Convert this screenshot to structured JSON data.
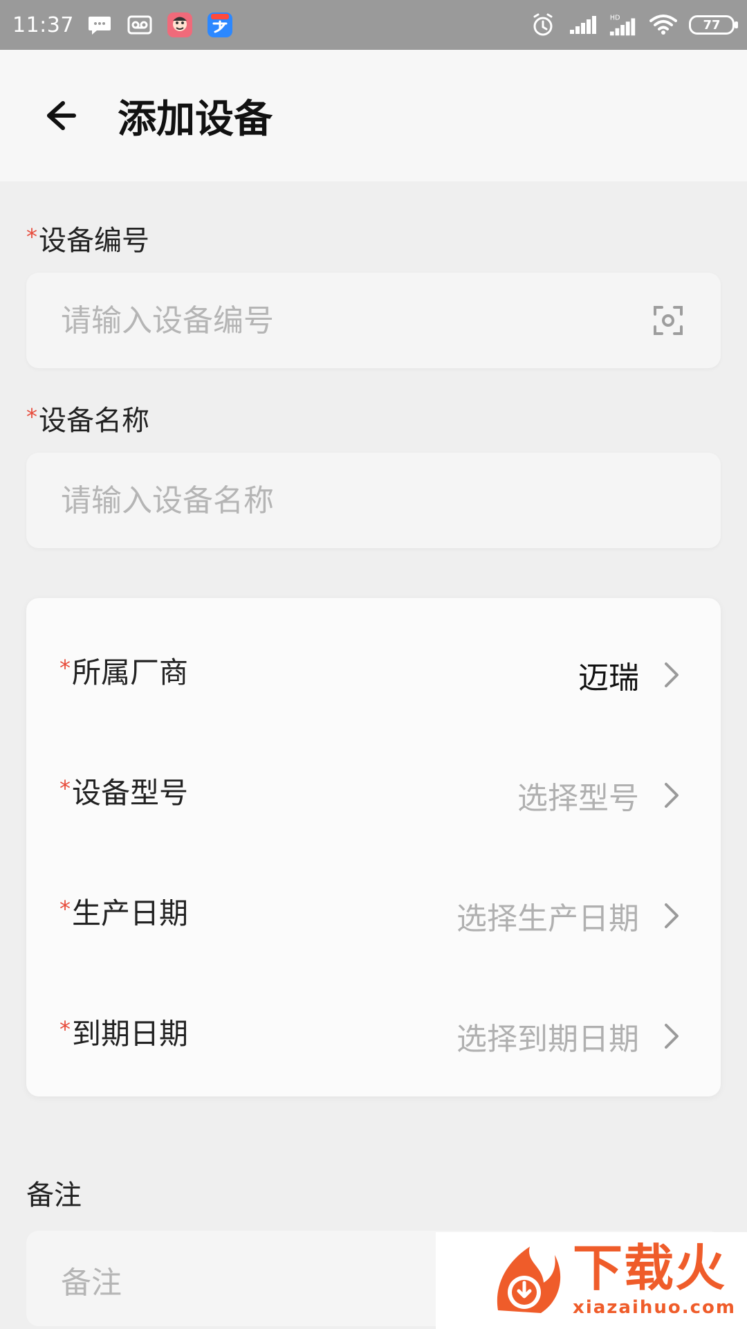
{
  "status_bar": {
    "time": "11:37",
    "battery": "77",
    "left_icons": [
      "message-icon",
      "voicemail-icon",
      "app-avatar-icon",
      "alipay-icon"
    ],
    "right_icons": [
      "alarm-icon",
      "signal-icon",
      "hd-signal-icon",
      "wifi-icon",
      "battery-icon"
    ]
  },
  "header": {
    "title": "添加设备",
    "back_icon": "back-arrow-icon"
  },
  "form": {
    "device_number": {
      "label": "设备编号",
      "placeholder": "请输入设备编号",
      "value": "",
      "required": "*"
    },
    "device_name": {
      "label": "设备名称",
      "placeholder": "请输入设备名称",
      "value": "",
      "required": "*"
    },
    "card_rows": [
      {
        "required": "*",
        "label": "所属厂商",
        "value": "迈瑞",
        "state": "selected"
      },
      {
        "required": "*",
        "label": "设备型号",
        "value": "选择型号",
        "state": "placeholder"
      },
      {
        "required": "*",
        "label": "生产日期",
        "value": "选择生产日期",
        "state": "placeholder"
      },
      {
        "required": "*",
        "label": "到期日期",
        "value": "选择到期日期",
        "state": "placeholder"
      }
    ],
    "note": {
      "label": "备注",
      "placeholder": "备注",
      "value": ""
    }
  },
  "watermark": {
    "cn": "下载火",
    "url": "xiazaihuo.com"
  },
  "colors": {
    "required": "#e74c3c",
    "placeholder": "#b5b5b5",
    "watermark": "#ef5c2a"
  }
}
